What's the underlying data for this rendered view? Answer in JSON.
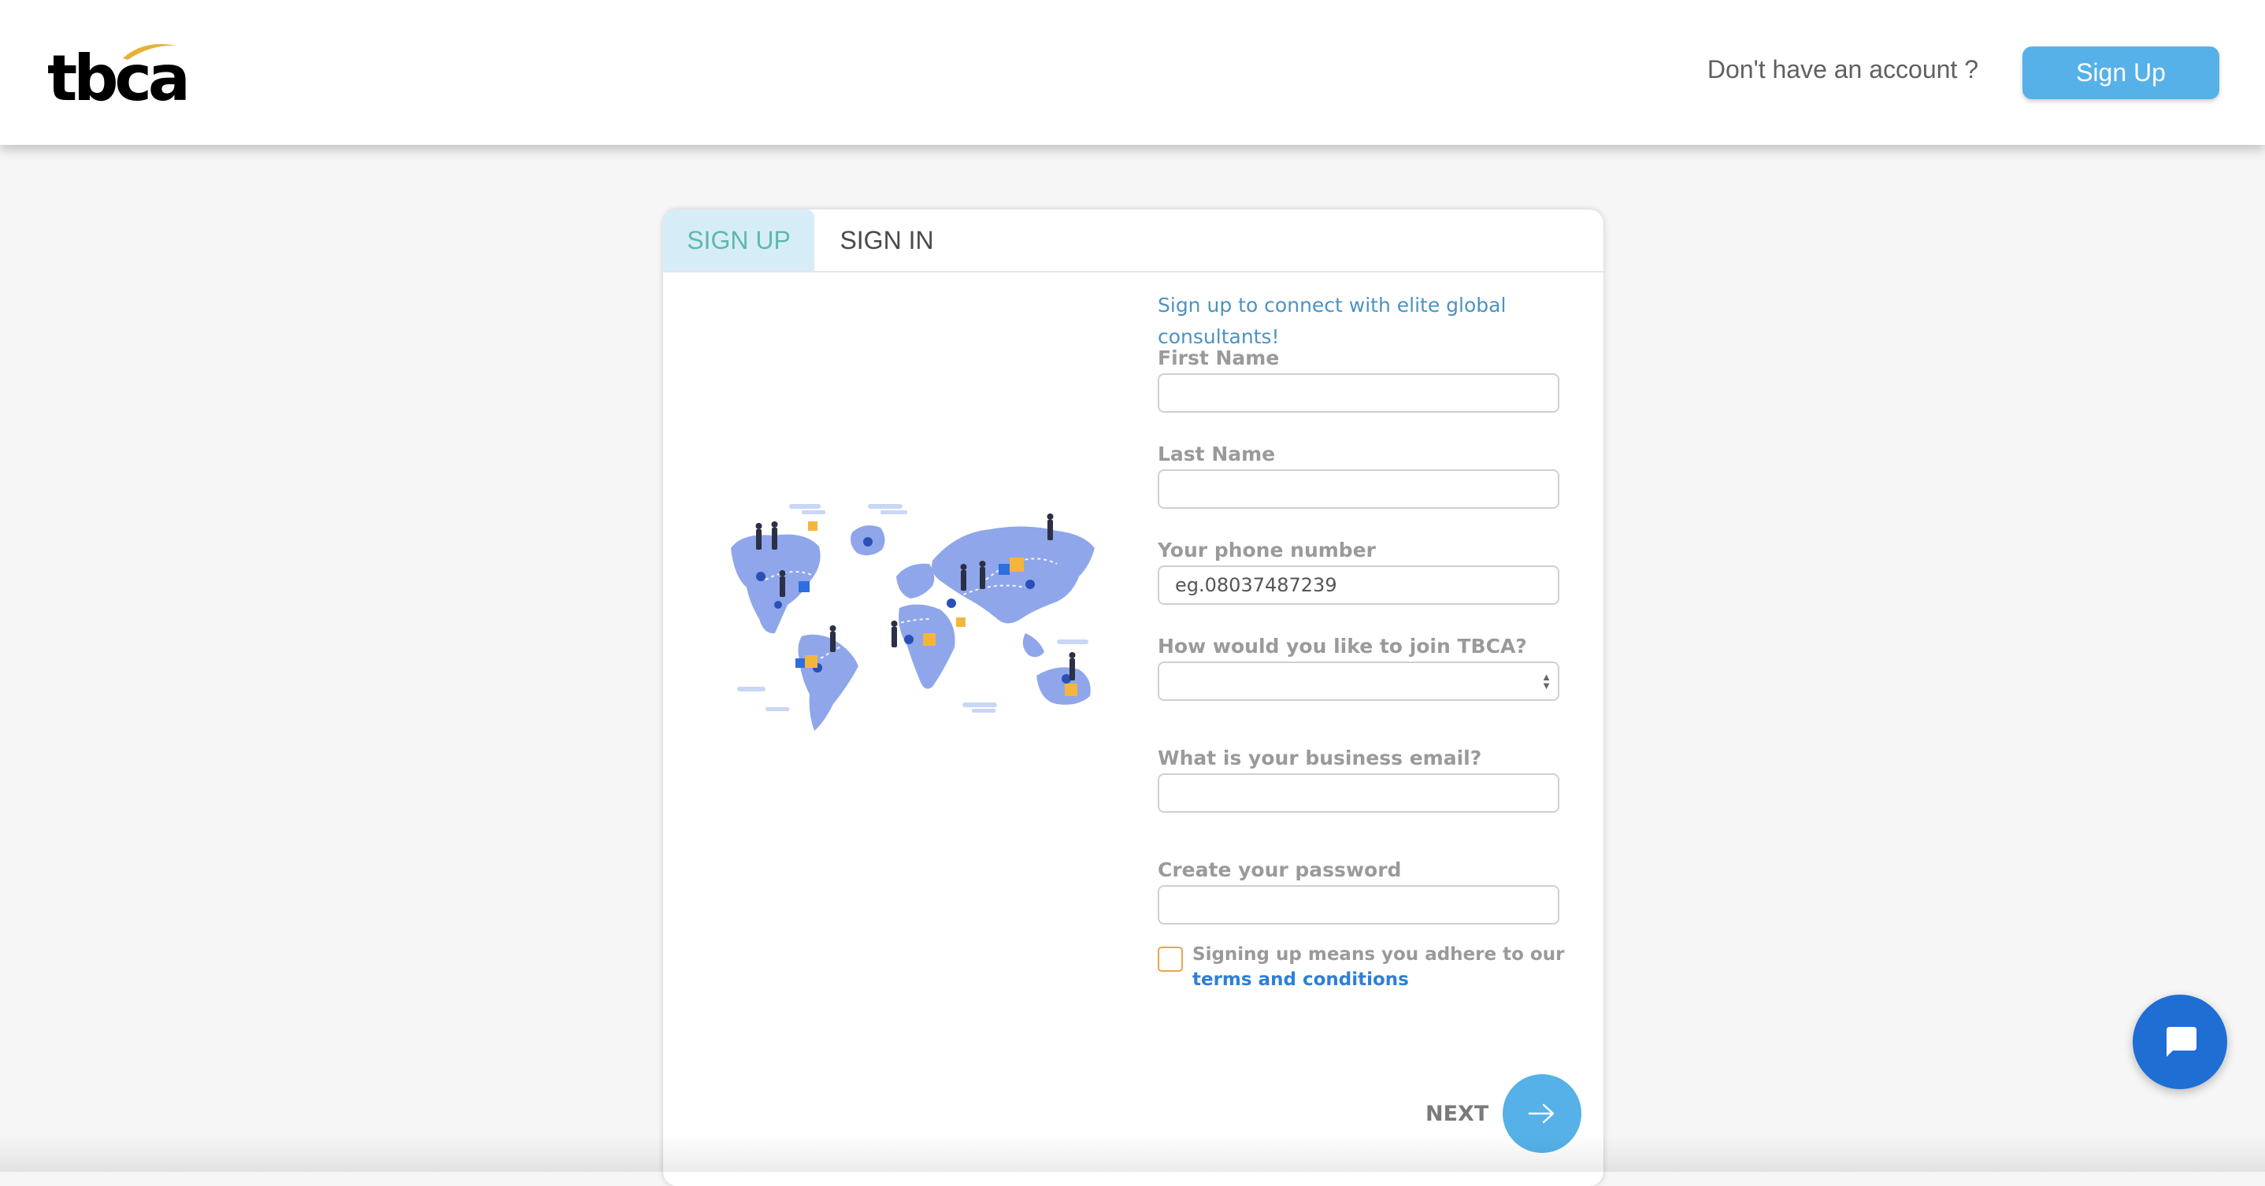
{
  "header": {
    "logo_text": "tbca",
    "account_prompt": "Don't have an account ?",
    "signup_button_label": "Sign Up"
  },
  "tabs": [
    {
      "label": "SIGN UP",
      "active": true
    },
    {
      "label": "SIGN IN",
      "active": false
    }
  ],
  "form": {
    "tagline": "Sign up to connect with elite global consultants!",
    "first_name_label": "First Name",
    "first_name_value": "",
    "last_name_label": "Last Name",
    "last_name_value": "",
    "phone_label": "Your phone number",
    "phone_placeholder": "eg.08037487239",
    "join_label": "How would you like to join TBCA?",
    "join_selected": "",
    "email_label": "What is your business email?",
    "email_value": "",
    "password_label": "Create your password",
    "password_value": "",
    "terms_prefix": "Signing up means you adhere to our",
    "terms_link": "terms and conditions",
    "terms_checked": false,
    "next_label": "NEXT"
  },
  "icons": {
    "next": "arrow-right-icon",
    "chat": "chat-bubble-icon"
  },
  "colors": {
    "primary_button": "#55b1e8",
    "active_tab_bg": "#d6edf8",
    "active_tab_text": "#5dbaa6",
    "tagline": "#4c93c0",
    "link": "#2e7fd6",
    "checkbox_border": "#f0a24a",
    "chat_button": "#1f6ed4",
    "map": "#8fa6ea"
  }
}
